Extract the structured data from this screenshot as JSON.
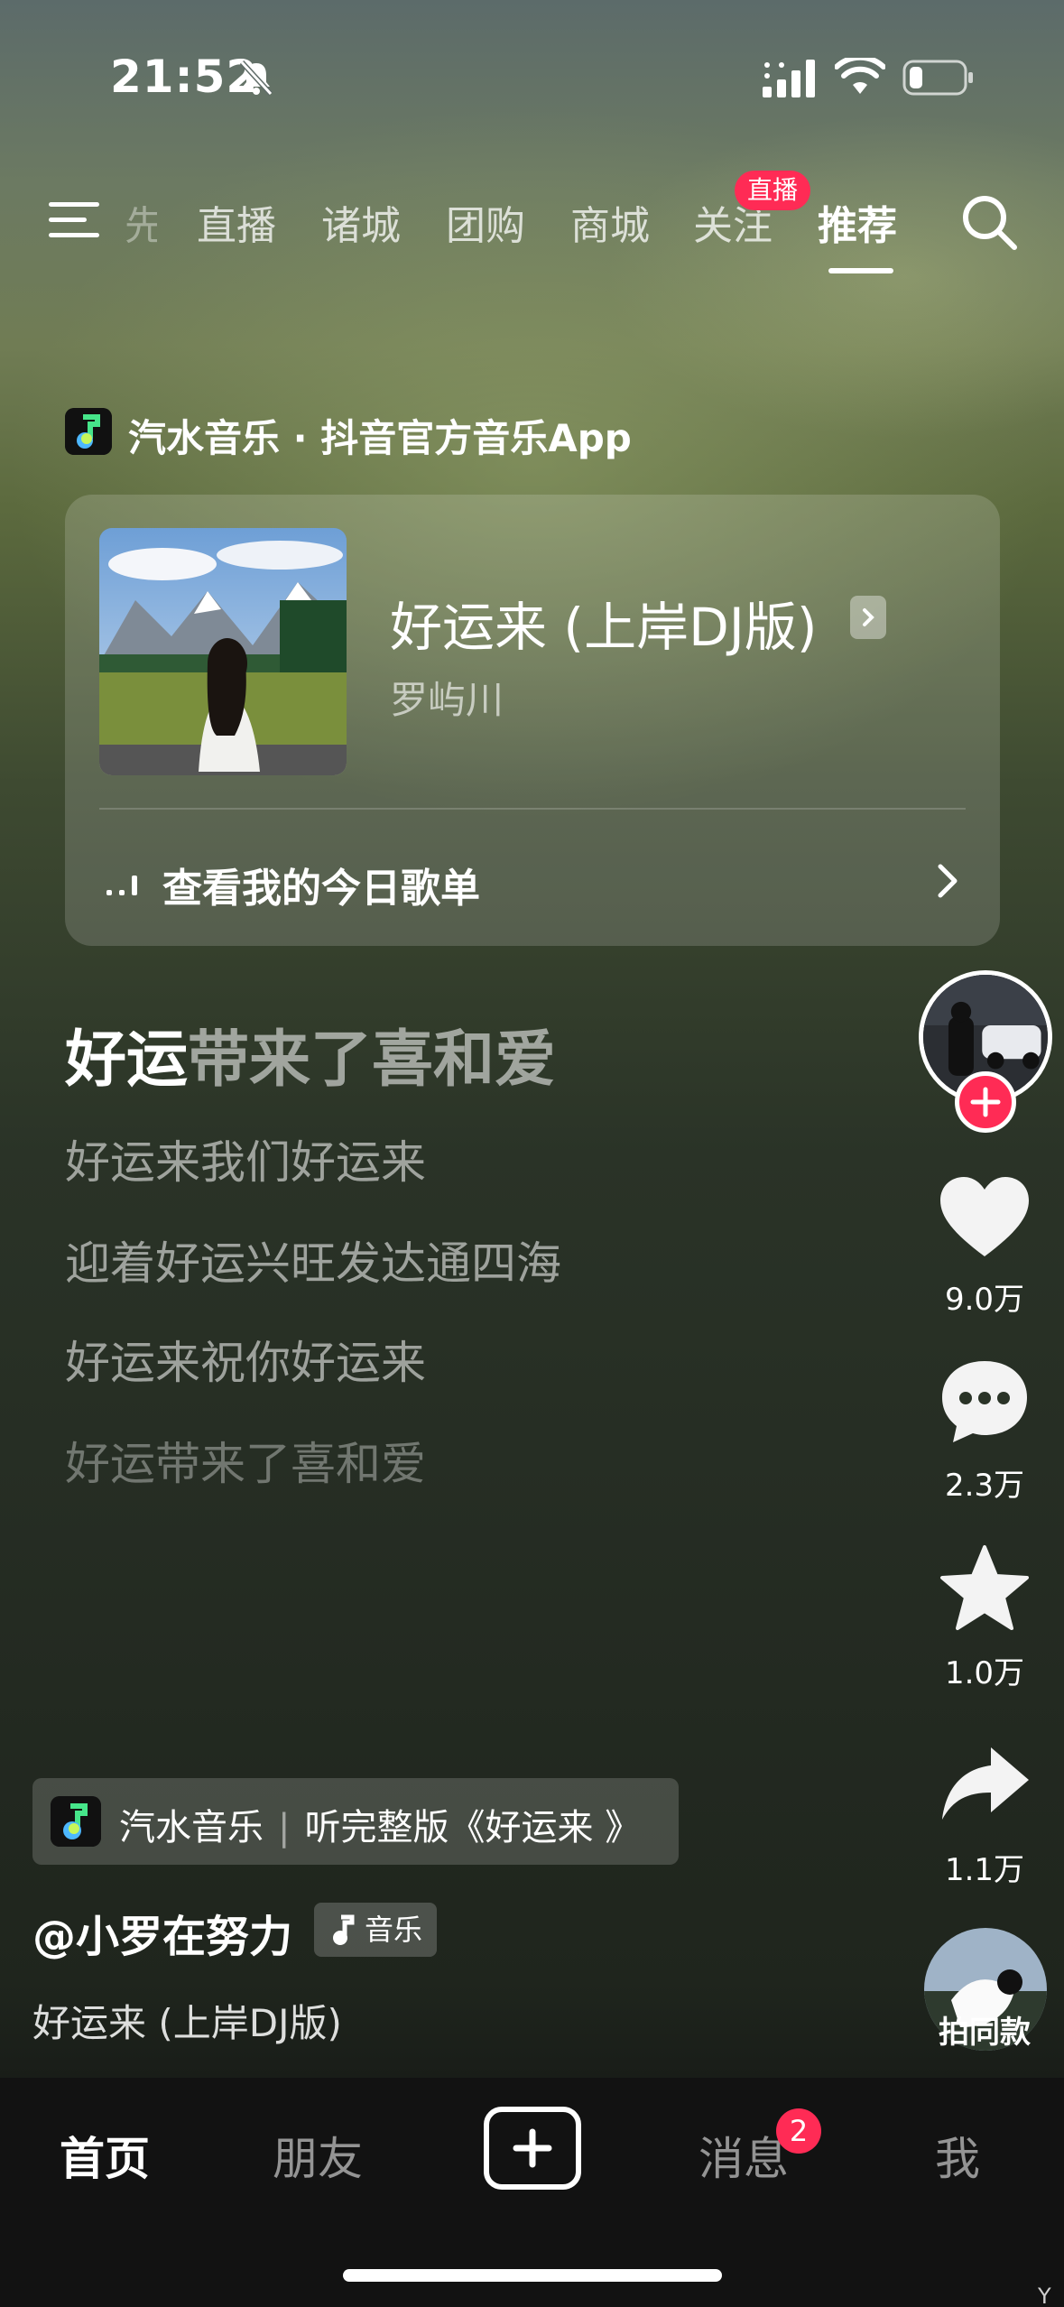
{
  "status_bar": {
    "time": "21:52",
    "icons": [
      "bell-off-icon",
      "signal-icon",
      "wifi-icon",
      "battery-icon"
    ]
  },
  "top_nav": {
    "partial_tab": "先",
    "tabs": [
      {
        "label": "直播",
        "active": false
      },
      {
        "label": "诸城",
        "active": false
      },
      {
        "label": "团购",
        "active": false
      },
      {
        "label": "商城",
        "active": false
      },
      {
        "label": "关注",
        "active": false
      },
      {
        "label": "推荐",
        "active": true
      }
    ],
    "live_badge": "直播",
    "icons": [
      "menu-icon",
      "search-icon"
    ]
  },
  "qishui": {
    "header": "汽水音乐 · 抖音官方音乐App",
    "song_title": "好运来 (上岸DJ版)",
    "artist": "罗屿川",
    "playlist_label": "查看我的今日歌单"
  },
  "lyrics": {
    "current_highlight": "好运",
    "current_rest": "带来了喜和爱",
    "lines": [
      "好运来我们好运来",
      "迎着好运兴旺发达通四海",
      "好运来祝你好运来",
      "好运带来了喜和爱"
    ]
  },
  "right_rail": {
    "like_count": "9.0万",
    "comment_count": "2.3万",
    "favorite_count": "1.0万",
    "share_count": "1.1万",
    "same_style_label": "拍同款"
  },
  "bottom_info": {
    "chip_app": "汽水音乐",
    "chip_action": "听完整版《好运来 》",
    "author": "@小罗在努力",
    "music_tag": "音乐",
    "description": "好运来 (上岸DJ版)"
  },
  "bottom_nav": {
    "home": "首页",
    "friends": "朋友",
    "messages": "消息",
    "messages_badge": "2",
    "me": "我"
  },
  "corner_char": "Y",
  "colors": {
    "accent_red": "#ff2b55",
    "nav_background": "#121212"
  }
}
